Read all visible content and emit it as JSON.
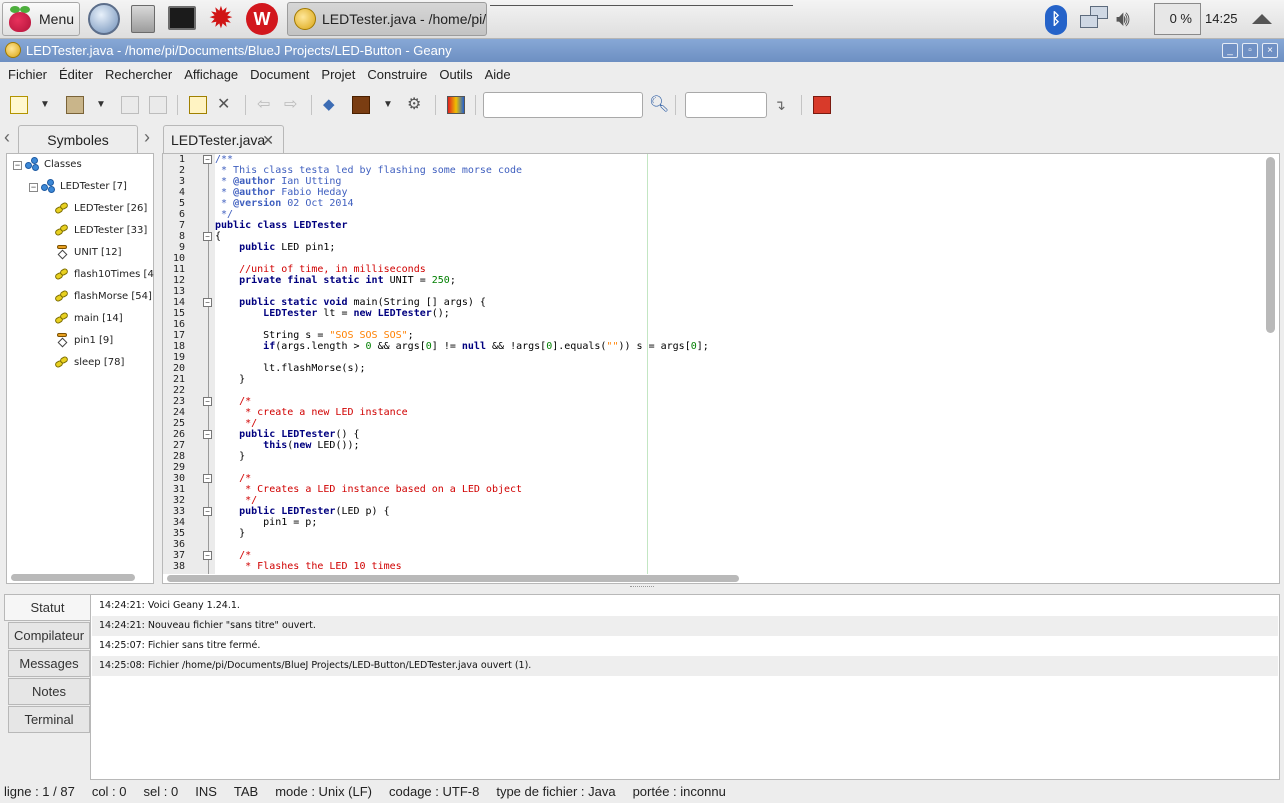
{
  "taskbar": {
    "menu_label": "Menu",
    "task_label": "LEDTester.java - /home/pi/...",
    "cpu": "0 %",
    "clock": "14:25",
    "icons": [
      "raspberry-icon",
      "web-browser-icon",
      "file-manager-icon",
      "terminal-icon",
      "mathematica-icon",
      "wolfram-icon",
      "bluetooth-icon",
      "network-icon",
      "volume-icon",
      "eject-icon"
    ]
  },
  "window": {
    "title": "LEDTester.java - /home/pi/Documents/BlueJ Projects/LED-Button - Geany",
    "controls": [
      "_",
      "▫",
      "×"
    ]
  },
  "menubar": [
    "Fichier",
    "Éditer",
    "Rechercher",
    "Affichage",
    "Document",
    "Projet",
    "Construire",
    "Outils",
    "Aide"
  ],
  "toolbar": {
    "search_value": "",
    "goto_value": "",
    "icons": [
      "new-file-icon",
      "open-file-icon",
      "save-icon",
      "save-all-icon",
      "reload-icon",
      "close-file-icon",
      "back-icon",
      "forward-icon",
      "compile-icon",
      "build-icon",
      "execute-icon",
      "color-chooser-icon",
      "search-icon",
      "jump-to-line-icon",
      "quit-icon"
    ]
  },
  "sidebar": {
    "tab": "Symboles",
    "tree": [
      {
        "label": "Classes",
        "kind": "class",
        "level": 0,
        "expander": "−"
      },
      {
        "label": "LEDTester [7]",
        "kind": "class",
        "level": 1,
        "expander": "−"
      },
      {
        "label": "LEDTester [26]",
        "kind": "method",
        "level": 2
      },
      {
        "label": "LEDTester [33]",
        "kind": "method",
        "level": 2
      },
      {
        "label": "UNIT [12]",
        "kind": "field",
        "level": 2
      },
      {
        "label": "flash10Times [4",
        "kind": "method",
        "level": 2
      },
      {
        "label": "flashMorse [54]",
        "kind": "method",
        "level": 2
      },
      {
        "label": "main [14]",
        "kind": "method",
        "level": 2
      },
      {
        "label": "pin1 [9]",
        "kind": "field",
        "level": 2
      },
      {
        "label": "sleep [78]",
        "kind": "method",
        "level": 2
      }
    ]
  },
  "editor": {
    "tab_label": "LEDTester.java",
    "tab_close": "✕",
    "folds": [
      1,
      8,
      14,
      23,
      26,
      30,
      33,
      37
    ],
    "lines": [
      [
        [
          "c-com",
          "/**"
        ]
      ],
      [
        [
          "c-com",
          " * This class testa led by flashing some morse code"
        ]
      ],
      [
        [
          "c-com",
          " * "
        ],
        [
          "c-ann",
          "@author"
        ],
        [
          "c-com",
          " Ian Utting"
        ]
      ],
      [
        [
          "c-com",
          " * "
        ],
        [
          "c-ann",
          "@author"
        ],
        [
          "c-com",
          " Fabio Heday"
        ]
      ],
      [
        [
          "c-com",
          " * "
        ],
        [
          "c-ann",
          "@version"
        ],
        [
          "c-com",
          " 02 Oct 2014"
        ]
      ],
      [
        [
          "c-com",
          " */"
        ]
      ],
      [
        [
          "c-kw",
          "public class "
        ],
        [
          "c-cls",
          "LEDTester"
        ]
      ],
      [
        [
          "c-plain",
          "{"
        ]
      ],
      [
        [
          "c-plain",
          "    "
        ],
        [
          "c-kw",
          "public"
        ],
        [
          "c-plain",
          " LED pin1;"
        ]
      ],
      [
        [
          "c-plain",
          ""
        ]
      ],
      [
        [
          "c-plain",
          "    "
        ],
        [
          "c-cmt",
          "//unit of time, in milliseconds"
        ]
      ],
      [
        [
          "c-plain",
          "    "
        ],
        [
          "c-kw",
          "private final static int"
        ],
        [
          "c-plain",
          " UNIT = "
        ],
        [
          "c-num",
          "250"
        ],
        [
          "c-plain",
          ";"
        ]
      ],
      [
        [
          "c-plain",
          ""
        ]
      ],
      [
        [
          "c-plain",
          "    "
        ],
        [
          "c-kw",
          "public static void"
        ],
        [
          "c-plain",
          " main(String [] args) {"
        ]
      ],
      [
        [
          "c-plain",
          "        "
        ],
        [
          "c-cls",
          "LEDTester"
        ],
        [
          "c-plain",
          " lt = "
        ],
        [
          "c-kw",
          "new"
        ],
        [
          "c-plain",
          " "
        ],
        [
          "c-cls",
          "LEDTester"
        ],
        [
          "c-plain",
          "();"
        ]
      ],
      [
        [
          "c-plain",
          ""
        ]
      ],
      [
        [
          "c-plain",
          "        String s = "
        ],
        [
          "c-str",
          "\"SOS SOS SOS\""
        ],
        [
          "c-plain",
          ";"
        ]
      ],
      [
        [
          "c-plain",
          "        "
        ],
        [
          "c-kw",
          "if"
        ],
        [
          "c-plain",
          "(args.length > "
        ],
        [
          "c-num",
          "0"
        ],
        [
          "c-plain",
          " && args["
        ],
        [
          "c-num",
          "0"
        ],
        [
          "c-plain",
          "] != "
        ],
        [
          "c-kw",
          "null"
        ],
        [
          "c-plain",
          " && !args["
        ],
        [
          "c-num",
          "0"
        ],
        [
          "c-plain",
          "].equals("
        ],
        [
          "c-str",
          "\"\""
        ],
        [
          "c-plain",
          ")) s = args["
        ],
        [
          "c-num",
          "0"
        ],
        [
          "c-plain",
          "];"
        ]
      ],
      [
        [
          "c-plain",
          ""
        ]
      ],
      [
        [
          "c-plain",
          "        lt.flashMorse(s);"
        ]
      ],
      [
        [
          "c-plain",
          "    }"
        ]
      ],
      [
        [
          "c-plain",
          ""
        ]
      ],
      [
        [
          "c-plain",
          "    "
        ],
        [
          "c-cmt",
          "/*"
        ]
      ],
      [
        [
          "c-plain",
          "    "
        ],
        [
          "c-cmt",
          " * create a new LED instance"
        ]
      ],
      [
        [
          "c-plain",
          "    "
        ],
        [
          "c-cmt",
          " */"
        ]
      ],
      [
        [
          "c-plain",
          "    "
        ],
        [
          "c-kw",
          "public"
        ],
        [
          "c-plain",
          " "
        ],
        [
          "c-cls",
          "LEDTester"
        ],
        [
          "c-plain",
          "() {"
        ]
      ],
      [
        [
          "c-plain",
          "        "
        ],
        [
          "c-kw",
          "this"
        ],
        [
          "c-plain",
          "("
        ],
        [
          "c-kw",
          "new"
        ],
        [
          "c-plain",
          " LED());"
        ]
      ],
      [
        [
          "c-plain",
          "    }"
        ]
      ],
      [
        [
          "c-plain",
          ""
        ]
      ],
      [
        [
          "c-plain",
          "    "
        ],
        [
          "c-cmt",
          "/*"
        ]
      ],
      [
        [
          "c-plain",
          "    "
        ],
        [
          "c-cmt",
          " * Creates a LED instance based on a LED object"
        ]
      ],
      [
        [
          "c-plain",
          "    "
        ],
        [
          "c-cmt",
          " */"
        ]
      ],
      [
        [
          "c-plain",
          "    "
        ],
        [
          "c-kw",
          "public"
        ],
        [
          "c-plain",
          " "
        ],
        [
          "c-cls",
          "LEDTester"
        ],
        [
          "c-plain",
          "(LED p) {"
        ]
      ],
      [
        [
          "c-plain",
          "        pin1 = p;"
        ]
      ],
      [
        [
          "c-plain",
          "    }"
        ]
      ],
      [
        [
          "c-plain",
          ""
        ]
      ],
      [
        [
          "c-plain",
          "    "
        ],
        [
          "c-cmt",
          "/*"
        ]
      ],
      [
        [
          "c-plain",
          "    "
        ],
        [
          "c-cmt",
          " * Flashes the LED 10 times"
        ]
      ]
    ]
  },
  "messages": {
    "tabs": [
      "Statut",
      "Compilateur",
      "Messages",
      "Notes",
      "Terminal"
    ],
    "active_tab": "Statut",
    "log": [
      "14:24:21: Voici Geany 1.24.1.",
      "14:24:21: Nouveau fichier \"sans titre\" ouvert.",
      "14:25:07: Fichier sans titre fermé.",
      "14:25:08: Fichier /home/pi/Documents/BlueJ Projects/LED-Button/LEDTester.java ouvert (1)."
    ]
  },
  "statusbar": {
    "line": "ligne : 1 / 87",
    "col": "col : 0",
    "sel": "sel : 0",
    "ins": "INS",
    "tab": "TAB",
    "mode": "mode : Unix (LF)",
    "encoding": "codage : UTF-8",
    "filetype": "type de fichier : Java",
    "scope": "portée : inconnu"
  }
}
